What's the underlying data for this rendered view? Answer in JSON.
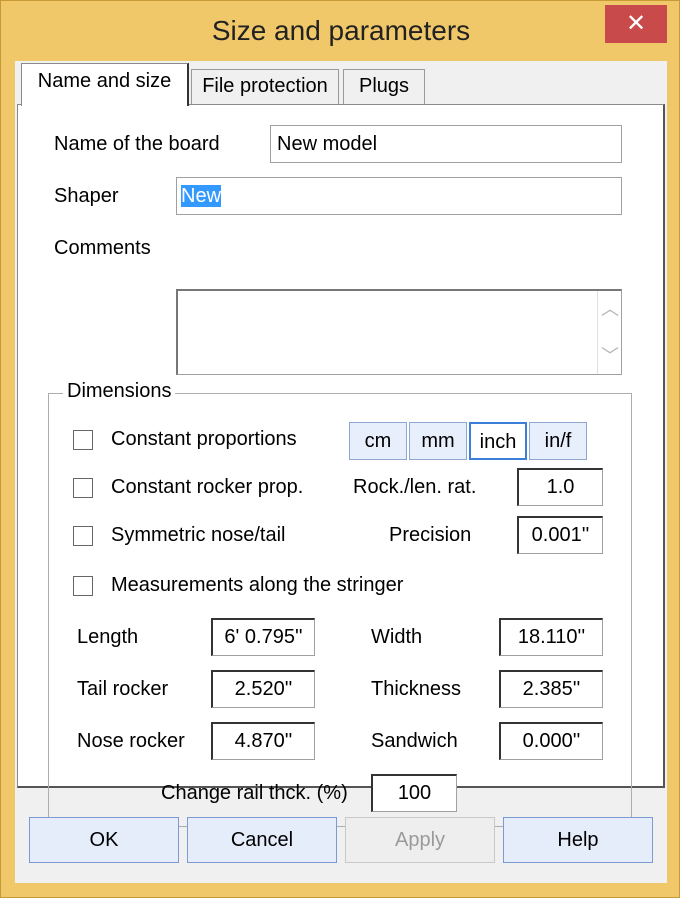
{
  "window": {
    "title": "Size and parameters",
    "close": "✕"
  },
  "tabs": [
    {
      "label": "Name and size"
    },
    {
      "label": "File protection"
    },
    {
      "label": "Plugs"
    }
  ],
  "general": {
    "name_label": "Name of the board",
    "name_value": "New model",
    "shaper_label": "Shaper",
    "shaper_value": "New",
    "comments_label": "Comments",
    "comments_value": "",
    "scroll_up": "︿",
    "scroll_down": "﹀"
  },
  "dimensions": {
    "group_title": "Dimensions",
    "checkboxes": [
      {
        "label": "Constant proportions",
        "checked": false
      },
      {
        "label": "Constant rocker prop.",
        "checked": false
      },
      {
        "label": "Symmetric nose/tail",
        "checked": false
      },
      {
        "label": "Measurements along the stringer",
        "checked": false
      }
    ],
    "units": [
      "cm",
      "mm",
      "inch",
      "in/f"
    ],
    "selected_unit": "inch",
    "rock_len_label": "Rock./len. rat.",
    "rock_len_value": "1.0",
    "precision_label": "Precision",
    "precision_value": "0.001''",
    "length_label": "Length",
    "length_value": "6' 0.795''",
    "tail_rocker_label": "Tail rocker",
    "tail_rocker_value": "2.520''",
    "nose_rocker_label": "Nose rocker",
    "nose_rocker_value": "4.870''",
    "width_label": "Width",
    "width_value": "18.110''",
    "thickness_label": "Thickness",
    "thickness_value": "2.385''",
    "sandwich_label": "Sandwich",
    "sandwich_value": "0.000''",
    "rail_label": "Change rail thck. (%)",
    "rail_value": "100"
  },
  "buttons": {
    "ok": "OK",
    "cancel": "Cancel",
    "apply": "Apply",
    "help": "Help"
  }
}
